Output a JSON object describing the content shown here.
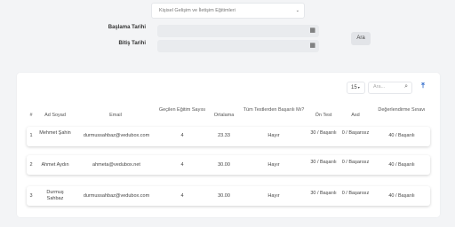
{
  "filter": {
    "course_select": "Kişisel Gelişim ve İletişim Eğitimleri",
    "start_label": "Başlama Tarihi",
    "end_label": "Bitiş Tarihi",
    "start_value": "",
    "end_value": "",
    "search_button": "Ara"
  },
  "toolbar": {
    "page_size": "15",
    "search_placeholder": "Ara..."
  },
  "table": {
    "headers": [
      "#",
      "Ad Soyad",
      "Email",
      "Geçilen Eğitim Sayısı",
      "Ortalama",
      "Tüm Testlerden Başarılı Mı?",
      "Ön Test",
      "Asd",
      "Değerlendirme Sınavı"
    ],
    "rows": [
      {
        "num": "1",
        "name": "Mehmet Şahin",
        "email": "durmussahbaz@vedubox.com",
        "passed": "4",
        "avg": "23.33",
        "all_passed": "Hayır",
        "pretest": "30 / Başarılı",
        "asd": "0 / Başarısız",
        "eval": "40 / Başarılı"
      },
      {
        "num": "2",
        "name": "Ahmet Aydın",
        "email": "ahmeta@vedubox.net",
        "passed": "4",
        "avg": "30.00",
        "all_passed": "Hayır",
        "pretest": "30 / Başarılı",
        "asd": "0 / Başarısız",
        "eval": "40 / Başarılı"
      },
      {
        "num": "3",
        "name": "Durmuş Sahbaz",
        "email": "durmussahbaz@vedubox.com",
        "passed": "4",
        "avg": "30.00",
        "all_passed": "Hayır",
        "pretest": "30 / Başarılı",
        "asd": "0 / Başarısız",
        "eval": "40 / Başarılı"
      }
    ]
  }
}
